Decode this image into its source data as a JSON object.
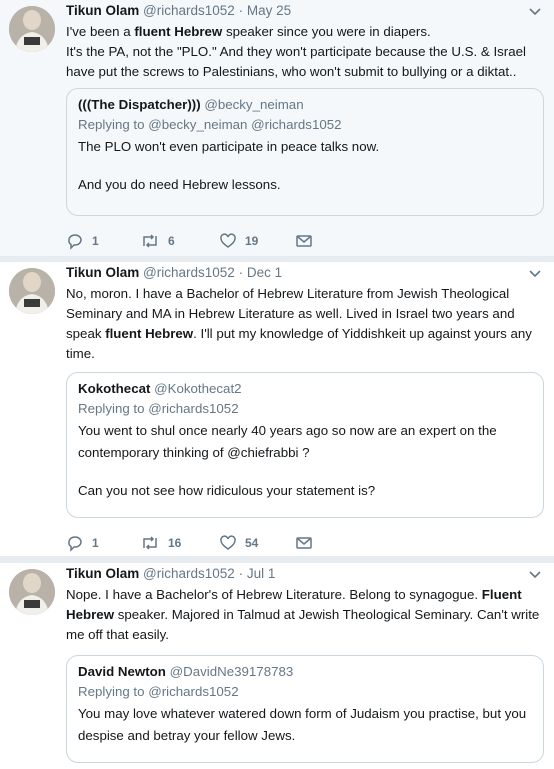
{
  "tweets": [
    {
      "name": "Tikun Olam",
      "handle": "@richards1052",
      "dot": "·",
      "date": "May 25",
      "text_parts": [
        {
          "t": "I've been a ",
          "b": false
        },
        {
          "t": "fluent Hebrew",
          "b": true
        },
        {
          "t": " speaker since you were in diapers.",
          "b": false
        },
        {
          "t": "It's the PA, not the \"PLO.\"  And they won't participate because the U.S. & Israel have put the screws to Palestinians, who won't submit to bullying or a diktat..",
          "b": false
        }
      ],
      "quote": {
        "name": "(((The Dispatcher)))",
        "handle": "@becky_neiman",
        "replying": "Replying to @becky_neiman @richards1052",
        "lines": [
          "The PLO won't even participate in peace talks now.",
          "",
          "And you do need Hebrew lessons."
        ]
      },
      "actions": {
        "replies": "1",
        "retweets": "6",
        "likes": "19"
      }
    },
    {
      "name": "Tikun Olam",
      "handle": "@richards1052",
      "dot": "·",
      "date": "Dec 1",
      "text_parts": [
        {
          "t": "No, moron. I have a Bachelor of Hebrew Literature from Jewish Theological Seminary and MA in Hebrew Literature as well. Lived in Israel two years and speak ",
          "b": false
        },
        {
          "t": "fluent Hebrew",
          "b": true
        },
        {
          "t": ". I'll put my knowledge of Yiddishkeit up against yours any time.",
          "b": false
        }
      ],
      "quote": {
        "name": "Kokothecat",
        "handle": "@Kokothecat2",
        "replying": "Replying to @richards1052",
        "lines": [
          "You went to shul once  nearly 40 years ago so now are an expert on the contemporary thinking of @chiefrabbi ?",
          "",
          "Can you not see how ridiculous your statement is?"
        ]
      },
      "actions": {
        "replies": "1",
        "retweets": "16",
        "likes": "54"
      }
    },
    {
      "name": "Tikun Olam",
      "handle": "@richards1052",
      "dot": "·",
      "date": "Jul 1",
      "text_parts": [
        {
          "t": "Nope. I have a Bachelor's of Hebrew Literature. Belong to synagogue. ",
          "b": false
        },
        {
          "t": "Fluent Hebrew",
          "b": true
        },
        {
          "t": " speaker. Majored in Talmud at Jewish Theological Seminary. Can't write me off that easily.",
          "b": false
        }
      ],
      "quote": {
        "name": "David Newton",
        "handle": "@DavidNe39178783",
        "replying": "Replying to @richards1052",
        "lines": [
          "You may love whatever watered down form of Judaism you practise, but you despise and betray your fellow Jews."
        ]
      }
    }
  ],
  "icons": {
    "reply": "reply-icon",
    "retweet": "retweet-icon",
    "like": "heart-icon",
    "dm": "envelope-icon",
    "caret": "chevron-down-icon"
  },
  "colors": {
    "name": "#14171a",
    "muted": "#657786",
    "border": "#ccd6dd",
    "alt_bg": "#f5f8fa"
  }
}
